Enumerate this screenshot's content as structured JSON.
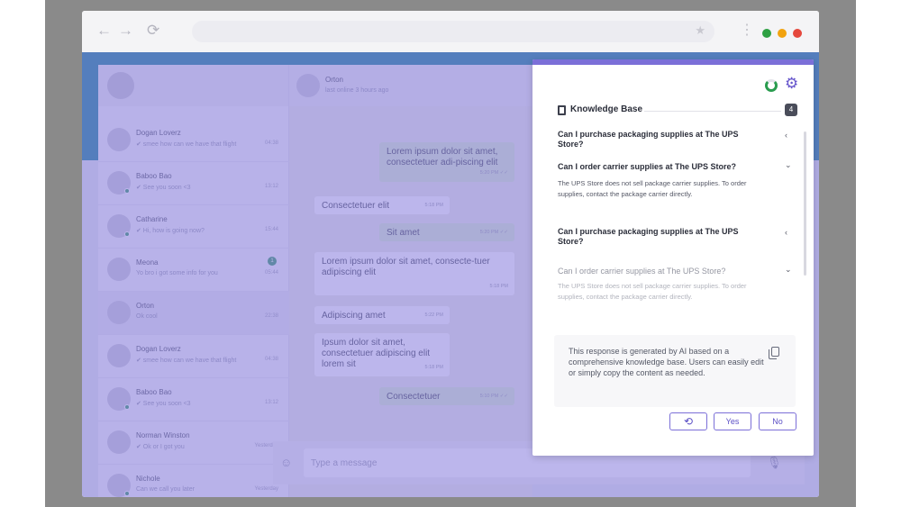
{
  "browser": {
    "back_icon": "←",
    "forward_icon": "→",
    "reload_icon": "⟳",
    "bookmark_icon": "★",
    "menu_icon": "⋮",
    "window_colors": [
      "#2ea043",
      "#f2a30f",
      "#e5483d"
    ]
  },
  "chat": {
    "contacts": [
      {
        "name": "Dogan Loverz",
        "preview": "✔ smee how can we have that flight",
        "time": "04:38",
        "badge": ""
      },
      {
        "name": "Baboo Bao",
        "preview": "✔ See you soon <3",
        "time": "13:12",
        "badge": ""
      },
      {
        "name": "Catharine",
        "preview": "✔ Hi, how is going now?",
        "time": "15:44",
        "badge": ""
      },
      {
        "name": "Meona",
        "preview": "Yo bro i got some info for you",
        "time": "05:44",
        "badge": "1"
      },
      {
        "name": "Orton",
        "preview": "Ok cool",
        "time": "22:38",
        "badge": ""
      },
      {
        "name": "Dogan Loverz",
        "preview": "✔ smee how can we have that flight",
        "time": "04:38",
        "badge": ""
      },
      {
        "name": "Baboo Bao",
        "preview": "✔ See you soon <3",
        "time": "13:12",
        "badge": ""
      },
      {
        "name": "Norman Winston",
        "preview": "✔ Ok or I got you",
        "time": "Yesterday",
        "badge": ""
      },
      {
        "name": "Nichole",
        "preview": "Can we call you later",
        "time": "Yesterday",
        "badge": ""
      }
    ],
    "header": {
      "name": "Orton",
      "status": "last online 3 hours ago"
    },
    "messages": [
      {
        "text": "Lorem ipsum dolor sit amet, consectetuer adi-piscing elit",
        "time": "5:20 PM ✓✓"
      },
      {
        "text": "Consectetuer elit",
        "time": "5:18 PM"
      },
      {
        "text": "Sit amet",
        "time": "5:20 PM ✓✓"
      },
      {
        "text": "Lorem ipsum dolor sit amet, consecte-tuer adipiscing elit",
        "time": "5:18 PM"
      },
      {
        "text": "Adipiscing amet",
        "time": "5:22 PM"
      },
      {
        "text": "Ipsum dolor sit amet, consectetuer adipiscing elit lorem sit",
        "time": "5:18 PM"
      },
      {
        "text": "Consectetuer",
        "time": "5:10 PM ✓✓"
      }
    ],
    "input_placeholder": "Type a message",
    "emoji_icon": "☺",
    "mic_icon": "🎙"
  },
  "kb": {
    "title": "Knowledge Base",
    "count": "4",
    "gear_icon": "⚙",
    "faqs": [
      {
        "q": "Can I purchase packaging supplies at The UPS Store?",
        "chevron": "‹",
        "a": ""
      },
      {
        "q": "Can I order carrier supplies at The UPS Store?",
        "chevron": "⌄",
        "a": "The UPS Store does not sell package carrier supplies. To order supplies, contact the package carrier directly."
      },
      {
        "q": "Can I purchase packaging supplies at The UPS Store?",
        "chevron": "‹",
        "a": ""
      },
      {
        "q": "Can I order carrier supplies at The UPS Store?",
        "chevron": "⌄",
        "a": "The UPS Store does not sell package carrier supplies. To order supplies, contact the package carrier directly."
      }
    ],
    "response": "This response is generated by AI based on a comprehensive knowledge base. Users can easily edit or simply copy the content as needed.",
    "regenerate_icon": "⟲",
    "yes_label": "Yes",
    "no_label": "No"
  }
}
